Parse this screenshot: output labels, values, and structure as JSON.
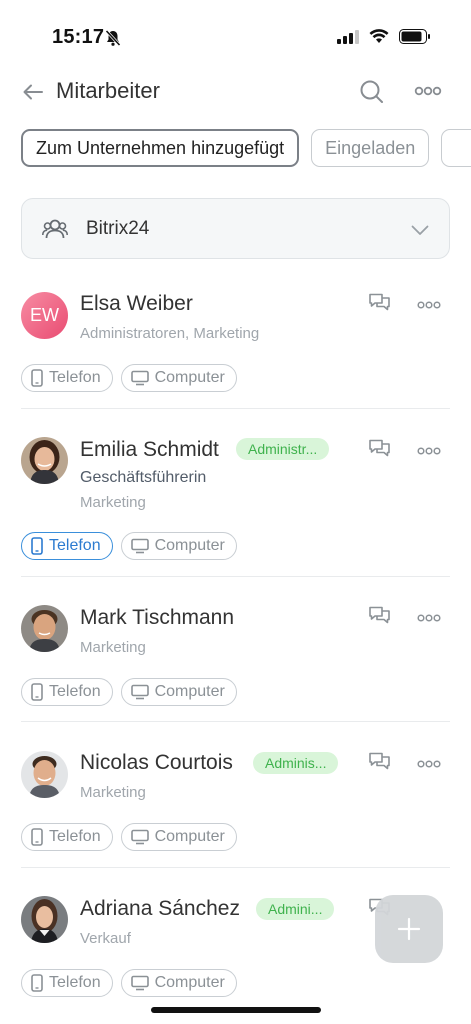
{
  "status_bar": {
    "time": "15:17"
  },
  "header": {
    "title": "Mitarbeiter"
  },
  "filters": [
    {
      "label": "Zum Unternehmen hinzugefügt"
    },
    {
      "label": "Eingeladen"
    },
    {
      "label": ""
    }
  ],
  "company": {
    "name": "Bitrix24"
  },
  "employees": [
    {
      "name": "Elsa Weiber",
      "initials": "EW",
      "badge": "",
      "position": "",
      "department": "Administratoren, Marketing",
      "phone_label": "Telefon",
      "computer_label": "Computer"
    },
    {
      "name": "Emilia Schmidt",
      "initials": "",
      "badge": "Administr...",
      "position": "Geschäftsführerin",
      "department": "Marketing",
      "phone_label": "Telefon",
      "computer_label": "Computer"
    },
    {
      "name": "Mark Tischmann",
      "initials": "",
      "badge": "",
      "position": "",
      "department": "Marketing",
      "phone_label": "Telefon",
      "computer_label": "Computer"
    },
    {
      "name": "Nicolas Courtois",
      "initials": "",
      "badge": "Adminis...",
      "position": "",
      "department": "Marketing",
      "phone_label": "Telefon",
      "computer_label": "Computer"
    },
    {
      "name": "Adriana Sánchez",
      "initials": "",
      "badge": "Admini...",
      "position": "",
      "department": "Verkauf",
      "phone_label": "Telefon",
      "computer_label": "Computer"
    }
  ],
  "colors": {
    "accent_blue": "#2c7bd0",
    "badge_green": "#3fb24d",
    "badge_bg": "#d9f5d9",
    "avatar_pink": "#e94c72"
  }
}
